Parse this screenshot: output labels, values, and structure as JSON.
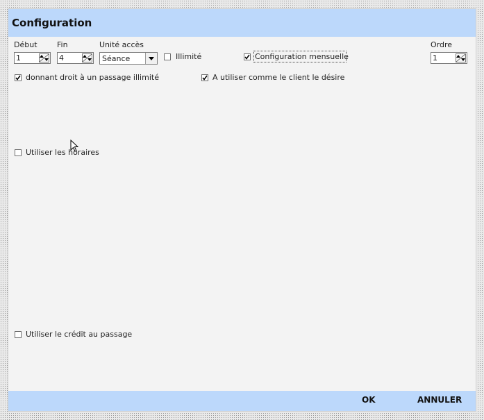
{
  "window": {
    "title": "Configuration"
  },
  "fields": {
    "debut": {
      "label": "Début",
      "value": "1"
    },
    "fin": {
      "label": "Fin",
      "value": "4"
    },
    "unite_acces": {
      "label": "Unité accès",
      "value": "Séance"
    },
    "illimite": {
      "label": "Illimité",
      "checked": false
    },
    "config_mensuelle": {
      "label": "Configuration mensuelle",
      "checked": true
    },
    "ordre": {
      "label": "Ordre",
      "value": "1"
    }
  },
  "options": {
    "passage_illimite": {
      "label": "donnant droit à un passage illimité",
      "checked": true
    },
    "utiliser_client": {
      "label": "A utiliser comme le client le désire",
      "checked": true
    },
    "utiliser_horaires": {
      "label": "Utiliser les horaires",
      "checked": false
    },
    "utiliser_credit": {
      "label": "Utiliser le crédit au passage",
      "checked": false
    }
  },
  "footer": {
    "ok": "OK",
    "cancel": "ANNULER"
  },
  "colors": {
    "header": "#bcd8fb",
    "panel": "#f3f3f3"
  }
}
